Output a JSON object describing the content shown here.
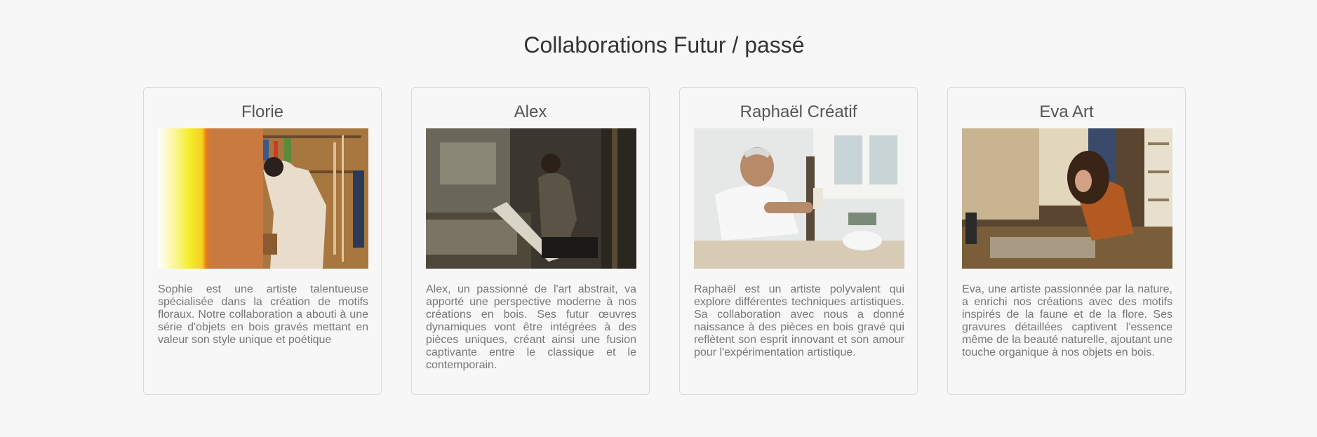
{
  "section": {
    "title": "Collaborations Futur / passé"
  },
  "cards": [
    {
      "name": "Florie",
      "image": "florie-workshop-photo",
      "description": "Sophie est une artiste talentueuse spécialisée dans la création de motifs floraux. Notre collaboration a abouti à une série d'objets en bois gravés mettant en valeur son style unique et poétique"
    },
    {
      "name": "Alex",
      "image": "alex-drawing-photo",
      "description": "Alex, un passionné de l'art abstrait, va apporté une perspective moderne à nos créations en bois. Ses futur œuvres dynamiques vont être intégrées à des pièces uniques, créant ainsi une fusion captivante entre le classique et le contemporain."
    },
    {
      "name": "Raphaël Créatif",
      "image": "raphael-workbench-photo",
      "description": "Raphaël est un artiste polyvalent qui explore différentes techniques artistiques. Sa collaboration avec nous a donné naissance à des pièces en bois gravé qui reflètent son esprit innovant et son amour pour l'expérimentation artistique."
    },
    {
      "name": "Eva Art",
      "image": "eva-painting-photo",
      "description": "Eva, une artiste passionnée par la nature, a enrichi nos créations avec des motifs inspirés de la faune et de la flore. Ses gravures détaillées captivent l'essence même de la beauté naturelle, ajoutant une touche organique à nos objets en bois."
    }
  ]
}
